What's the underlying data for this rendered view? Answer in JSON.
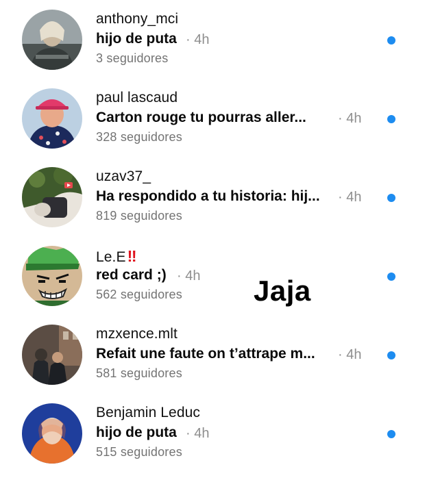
{
  "conversations": [
    {
      "username": "anthony_mci",
      "badge": "",
      "message": "hijo de puta",
      "time": "· 4h",
      "followers": "3 seguidores",
      "unread_color": "#1d8cf0"
    },
    {
      "username": "paul lascaud",
      "badge": "",
      "message": "Carton rouge tu pourras aller...",
      "time": "· 4h",
      "followers": "328 seguidores",
      "unread_color": "#1d8cf0"
    },
    {
      "username": "uzav37_",
      "badge": "",
      "message": "Ha respondido a tu historia: hij...",
      "time": "· 4h",
      "followers": "819 seguidores",
      "unread_color": "#1d8cf0"
    },
    {
      "username": "Le.E",
      "badge": "‼",
      "message": "red card ;)",
      "time": "· 4h",
      "followers": "562 seguidores",
      "unread_color": "#1d8cf0"
    },
    {
      "username": "mzxence.mlt",
      "badge": "",
      "message": "Refait une faute on t’attrape m...",
      "time": "· 4h",
      "followers": "581 seguidores",
      "unread_color": "#1d8cf0"
    },
    {
      "username": "Benjamin Leduc",
      "badge": "",
      "message": "hijo de puta",
      "time": "· 4h",
      "followers": "515 seguidores",
      "unread_color": "#1d8cf0"
    }
  ],
  "overlay_text": "Jaja"
}
